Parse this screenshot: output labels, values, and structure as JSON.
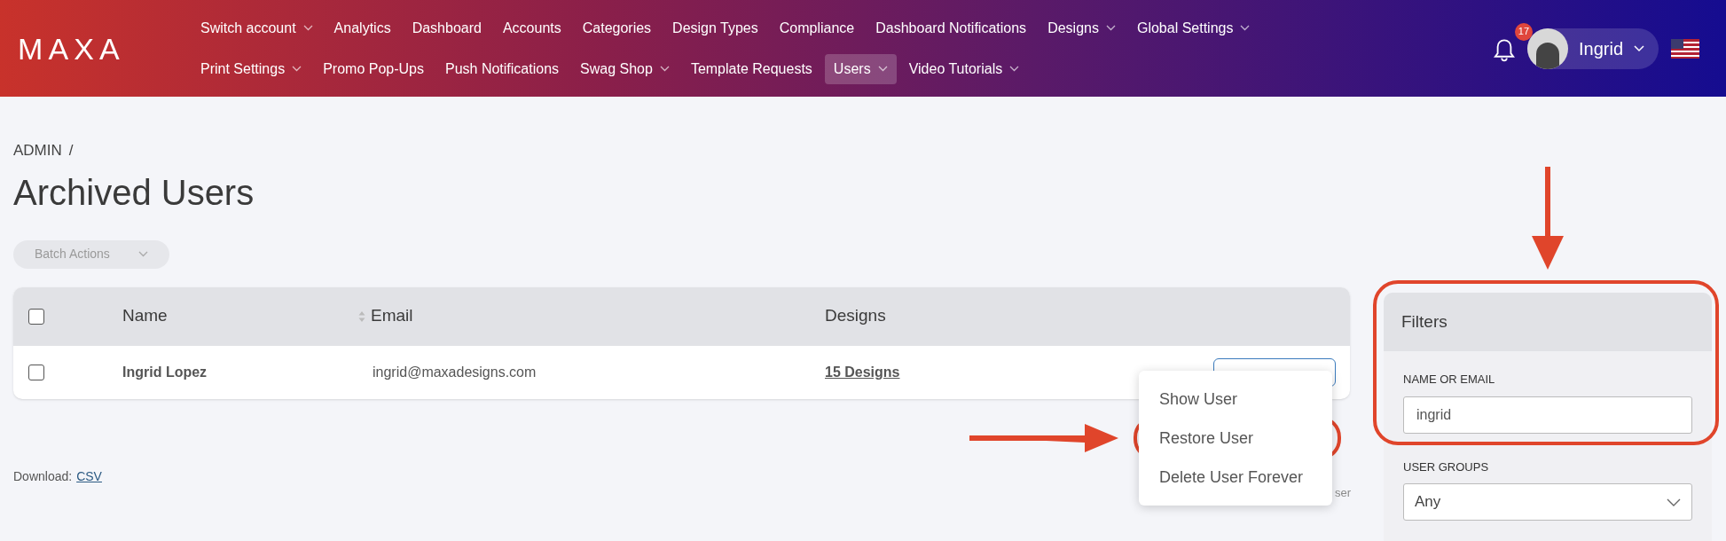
{
  "header": {
    "logo": "MAXA",
    "nav_rows": [
      [
        {
          "label": "Switch account",
          "dropdown": true,
          "selected": false
        },
        {
          "label": "Analytics",
          "dropdown": false,
          "selected": false
        },
        {
          "label": "Dashboard",
          "dropdown": false,
          "selected": false
        },
        {
          "label": "Accounts",
          "dropdown": false,
          "selected": false
        },
        {
          "label": "Categories",
          "dropdown": false,
          "selected": false
        },
        {
          "label": "Design Types",
          "dropdown": false,
          "selected": false
        },
        {
          "label": "Compliance",
          "dropdown": false,
          "selected": false
        },
        {
          "label": "Dashboard Notifications",
          "dropdown": false,
          "selected": false
        },
        {
          "label": "Designs",
          "dropdown": true,
          "selected": false
        },
        {
          "label": "Global Settings",
          "dropdown": true,
          "selected": false
        }
      ],
      [
        {
          "label": "Print Settings",
          "dropdown": true,
          "selected": false
        },
        {
          "label": "Promo Pop-Ups",
          "dropdown": false,
          "selected": false
        },
        {
          "label": "Push Notifications",
          "dropdown": false,
          "selected": false
        },
        {
          "label": "Swag Shop",
          "dropdown": true,
          "selected": false
        },
        {
          "label": "Template Requests",
          "dropdown": false,
          "selected": false
        },
        {
          "label": "Users",
          "dropdown": true,
          "selected": true
        },
        {
          "label": "Video Tutorials",
          "dropdown": true,
          "selected": false
        }
      ]
    ],
    "notifications": {
      "count": "17"
    },
    "user": {
      "name": "Ingrid"
    }
  },
  "breadcrumb": {
    "items": [
      "ADMIN"
    ],
    "separator": "/"
  },
  "title": "Archived Users",
  "batch_actions": {
    "label": "Batch Actions",
    "disabled": true
  },
  "table": {
    "select_all": {
      "checked": false
    },
    "columns": [
      {
        "label": "Name",
        "sortable": false
      },
      {
        "label": "Email",
        "sortable": true
      },
      {
        "label": "Designs",
        "sortable": false
      }
    ],
    "rows": [
      {
        "checked": false,
        "name": "Ingrid Lopez",
        "email": "ingrid@maxadesigns.com",
        "designs": "15 Designs"
      }
    ]
  },
  "context_menu": {
    "items": [
      {
        "label": "Show User",
        "highlighted": false
      },
      {
        "label": "Restore User",
        "highlighted": true
      },
      {
        "label": "Delete User Forever",
        "highlighted": false
      }
    ]
  },
  "count_note": "ser",
  "download": {
    "label": "Download:",
    "link": "CSV"
  },
  "filters": {
    "title": "Filters",
    "highlighted": true,
    "fields": [
      {
        "kind": "text",
        "label": "NAME OR EMAIL",
        "value": "ingrid"
      },
      {
        "kind": "select",
        "label": "USER GROUPS",
        "value": "Any"
      }
    ]
  }
}
